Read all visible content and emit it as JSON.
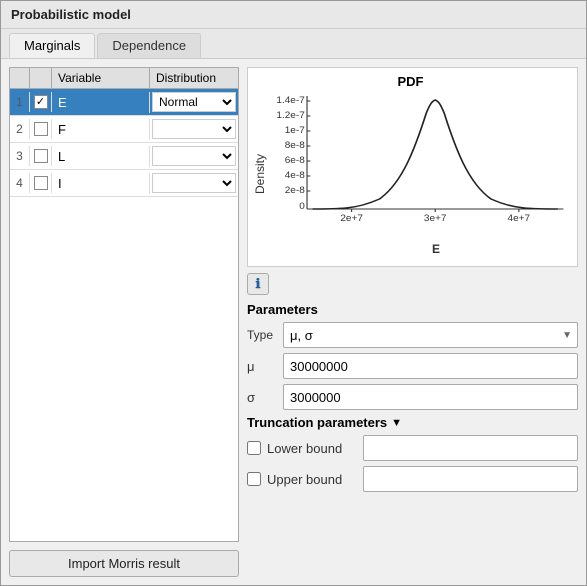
{
  "window": {
    "title": "Probabilistic model"
  },
  "tabs": [
    {
      "id": "marginals",
      "label": "Marginals",
      "active": true
    },
    {
      "id": "dependence",
      "label": "Dependence",
      "active": false
    }
  ],
  "variables_table": {
    "headers": {
      "variable": "Variable",
      "distribution": "Distribution"
    },
    "rows": [
      {
        "num": "1",
        "checked": true,
        "selected": true,
        "name": "E",
        "distribution": "Normal"
      },
      {
        "num": "2",
        "checked": false,
        "selected": false,
        "name": "F",
        "distribution": ""
      },
      {
        "num": "3",
        "checked": false,
        "selected": false,
        "name": "L",
        "distribution": ""
      },
      {
        "num": "4",
        "checked": false,
        "selected": false,
        "name": "I",
        "distribution": ""
      }
    ]
  },
  "import_btn": "Import Morris result",
  "chart": {
    "title": "PDF",
    "y_axis_label": "Density",
    "x_axis_label": "E",
    "y_ticks": [
      "1.4e-7",
      "1.2e-7",
      "1e-7",
      "8e-8",
      "6e-8",
      "4e-8",
      "2e-8",
      "0"
    ],
    "x_ticks": [
      "2e+7",
      "3e+7",
      "4e+7"
    ]
  },
  "parameters": {
    "label": "Parameters",
    "type_label": "Type",
    "type_value": "μ, σ",
    "mu_label": "μ",
    "mu_value": "30000000",
    "sigma_label": "σ",
    "sigma_value": "3000000"
  },
  "truncation": {
    "label": "Truncation parameters",
    "lower_bound_label": "Lower bound",
    "upper_bound_label": "Upper bound",
    "lower_checked": false,
    "upper_checked": false,
    "lower_value": "",
    "upper_value": ""
  },
  "icons": {
    "info": "ℹ",
    "arrow_down": "▼",
    "checked": "✓"
  }
}
